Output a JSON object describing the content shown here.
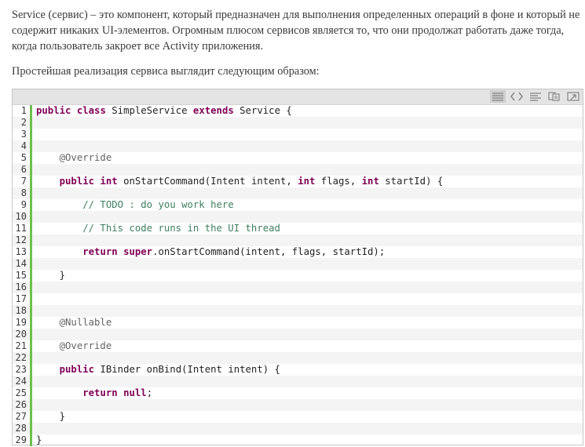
{
  "article": {
    "intro": "Service (сервис) – это компонент, который предназначен для выполнения определенных операций в фоне и который не содержит никаких UI-элементов. Огромным плюсом сервисов является то, что они продолжат работать даже тогда, когда пользователь закроет все Activity приложения.",
    "lead": "Простейшая реализация сервиса выглядит следующим образом:"
  },
  "toolbar": {
    "icons": [
      "view-source-icon",
      "highlight-icon",
      "wrap-icon",
      "copy-icon",
      "popup-icon"
    ]
  },
  "code": {
    "accent_color": "#6ec04f",
    "lines": [
      {
        "n": "1",
        "tokens": [
          {
            "t": "kw",
            "v": "public"
          },
          {
            "t": "tx",
            "v": " "
          },
          {
            "t": "kw",
            "v": "class"
          },
          {
            "t": "tx",
            "v": " SimpleService "
          },
          {
            "t": "kw",
            "v": "extends"
          },
          {
            "t": "tx",
            "v": " Service {"
          }
        ]
      },
      {
        "n": "2",
        "tokens": []
      },
      {
        "n": "3",
        "tokens": []
      },
      {
        "n": "4",
        "tokens": []
      },
      {
        "n": "5",
        "tokens": [
          {
            "t": "an",
            "v": "    @Override"
          }
        ]
      },
      {
        "n": "6",
        "tokens": []
      },
      {
        "n": "7",
        "tokens": [
          {
            "t": "tx",
            "v": "    "
          },
          {
            "t": "kw",
            "v": "public"
          },
          {
            "t": "tx",
            "v": " "
          },
          {
            "t": "kw",
            "v": "int"
          },
          {
            "t": "tx",
            "v": " onStartCommand(Intent intent, "
          },
          {
            "t": "kw",
            "v": "int"
          },
          {
            "t": "tx",
            "v": " flags, "
          },
          {
            "t": "kw",
            "v": "int"
          },
          {
            "t": "tx",
            "v": " startId) {"
          }
        ]
      },
      {
        "n": "8",
        "tokens": []
      },
      {
        "n": "9",
        "tokens": [
          {
            "t": "cm",
            "v": "        // TODO : do you work here"
          }
        ]
      },
      {
        "n": "10",
        "tokens": []
      },
      {
        "n": "11",
        "tokens": [
          {
            "t": "cm",
            "v": "        // This code runs in the UI thread"
          }
        ]
      },
      {
        "n": "12",
        "tokens": []
      },
      {
        "n": "13",
        "tokens": [
          {
            "t": "tx",
            "v": "        "
          },
          {
            "t": "kw",
            "v": "return"
          },
          {
            "t": "tx",
            "v": " "
          },
          {
            "t": "kw",
            "v": "super"
          },
          {
            "t": "tx",
            "v": ".onStartCommand(intent, flags, startId);"
          }
        ]
      },
      {
        "n": "14",
        "tokens": []
      },
      {
        "n": "15",
        "tokens": [
          {
            "t": "tx",
            "v": "    }"
          }
        ]
      },
      {
        "n": "16",
        "tokens": []
      },
      {
        "n": "17",
        "tokens": []
      },
      {
        "n": "18",
        "tokens": []
      },
      {
        "n": "19",
        "tokens": [
          {
            "t": "an",
            "v": "    @Nullable"
          }
        ]
      },
      {
        "n": "20",
        "tokens": []
      },
      {
        "n": "21",
        "tokens": [
          {
            "t": "an",
            "v": "    @Override"
          }
        ]
      },
      {
        "n": "22",
        "tokens": []
      },
      {
        "n": "23",
        "tokens": [
          {
            "t": "tx",
            "v": "    "
          },
          {
            "t": "kw",
            "v": "public"
          },
          {
            "t": "tx",
            "v": " IBinder onBind(Intent intent) {"
          }
        ]
      },
      {
        "n": "24",
        "tokens": []
      },
      {
        "n": "25",
        "tokens": [
          {
            "t": "tx",
            "v": "        "
          },
          {
            "t": "kw",
            "v": "return"
          },
          {
            "t": "tx",
            "v": " "
          },
          {
            "t": "kw",
            "v": "null"
          },
          {
            "t": "tx",
            "v": ";"
          }
        ]
      },
      {
        "n": "26",
        "tokens": []
      },
      {
        "n": "27",
        "tokens": [
          {
            "t": "tx",
            "v": "    }"
          }
        ]
      },
      {
        "n": "28",
        "tokens": []
      },
      {
        "n": "29",
        "tokens": [
          {
            "t": "tx",
            "v": "}"
          }
        ]
      }
    ]
  }
}
